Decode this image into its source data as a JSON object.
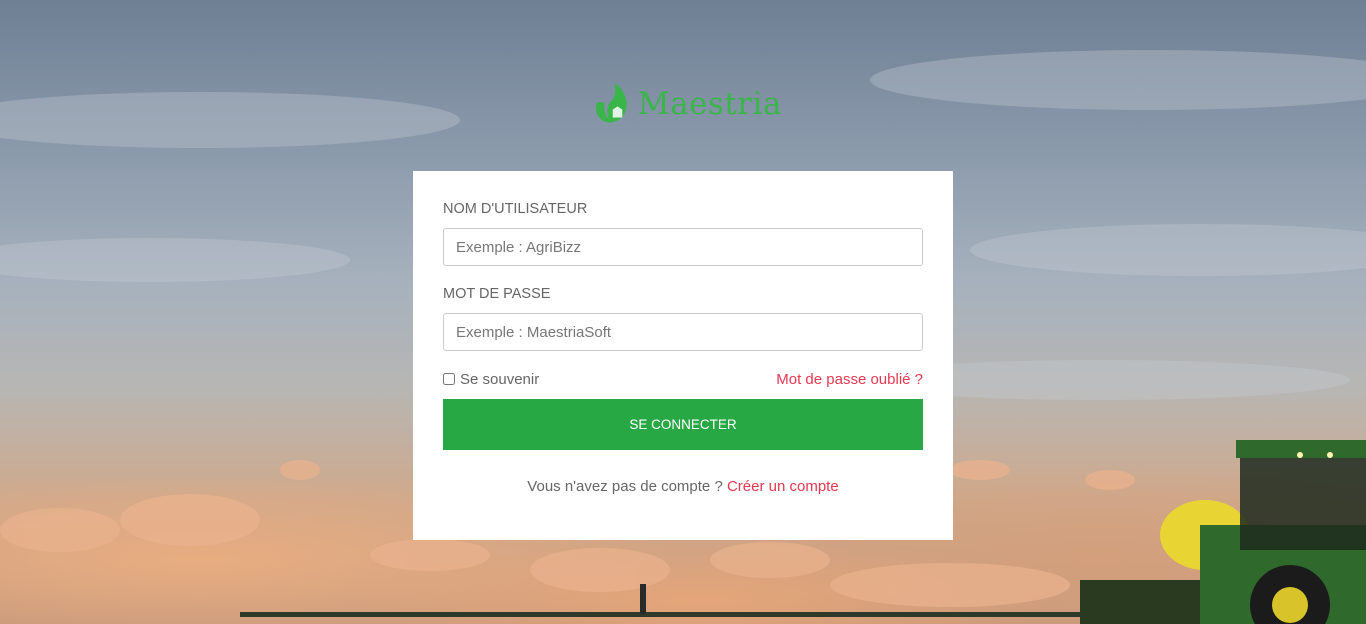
{
  "brand": {
    "name": "Maestria",
    "color": "#39b54a"
  },
  "login": {
    "username_label": "NOM D'UTILISATEUR",
    "username_placeholder": "Exemple : AgriBizz",
    "username_value": "",
    "password_label": "MOT DE PASSE",
    "password_placeholder": "Exemple : MaestriaSoft",
    "password_value": "",
    "remember_label": "Se souvenir",
    "remember_checked": false,
    "forgot_link": "Mot de passe oublié ?",
    "submit_label": "SE CONNECTER",
    "no_account_text": "Vous n'avez pas de compte ?",
    "create_account_link": "Créer un compte"
  },
  "colors": {
    "accent_button": "#28a745",
    "link": "#e53950"
  },
  "icons": {
    "logo": "leaf-logo-icon"
  }
}
